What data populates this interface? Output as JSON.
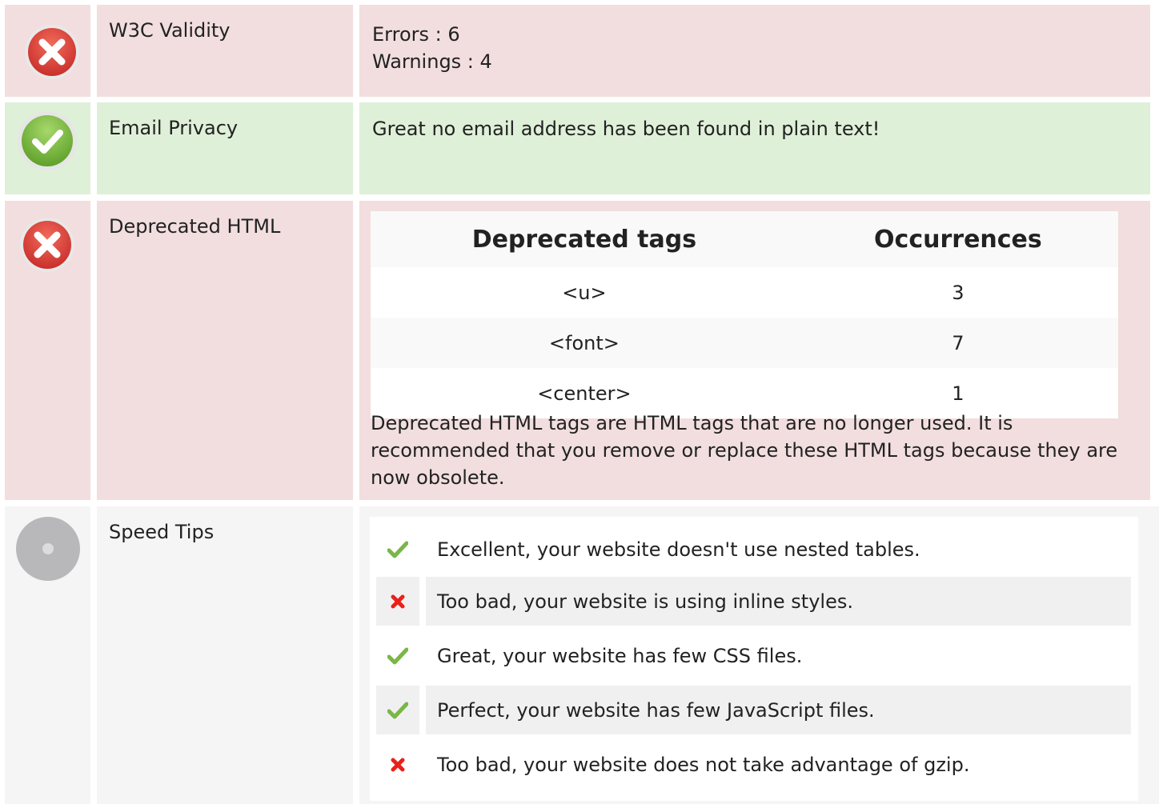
{
  "rows": [
    {
      "label": "W3C Validity",
      "status": "error",
      "status_icon": "error-circle-icon",
      "lines": [
        "Errors : 6",
        "Warnings : 4"
      ]
    },
    {
      "label": "Email Privacy",
      "status": "success",
      "status_icon": "success-circle-icon",
      "lines": [
        "Great no email address has been found in plain text!"
      ]
    },
    {
      "label": "Deprecated HTML",
      "status": "error",
      "status_icon": "error-circle-icon",
      "table": {
        "headers": [
          "Deprecated tags",
          "Occurrences"
        ],
        "rows": [
          {
            "tag": "<u>",
            "count": "3"
          },
          {
            "tag": "<font>",
            "count": "7"
          },
          {
            "tag": "<center>",
            "count": "1"
          }
        ]
      },
      "note": "Deprecated HTML tags are HTML tags that are no longer used. It is recommended that you remove or replace these HTML tags because they are now obsolete."
    },
    {
      "label": "Speed Tips",
      "status": "neutral",
      "status_icon": "neutral-circle-icon",
      "tips": [
        {
          "ok": true,
          "icon": "check-icon",
          "text": "Excellent, your website doesn't use nested tables."
        },
        {
          "ok": false,
          "icon": "cross-icon",
          "text": "Too bad, your website is using inline styles."
        },
        {
          "ok": true,
          "icon": "check-icon",
          "text": "Great, your website has few CSS files."
        },
        {
          "ok": true,
          "icon": "check-icon",
          "text": "Perfect, your website has few JavaScript files."
        },
        {
          "ok": false,
          "icon": "cross-icon",
          "text": "Too bad, your website does not take advantage of gzip."
        }
      ]
    }
  ],
  "colors": {
    "error_bg": "#f2dede",
    "success_bg": "#dff0d8",
    "neutral_bg": "#f5f5f5",
    "check": "#7ab648",
    "cross": "#e8211b"
  }
}
